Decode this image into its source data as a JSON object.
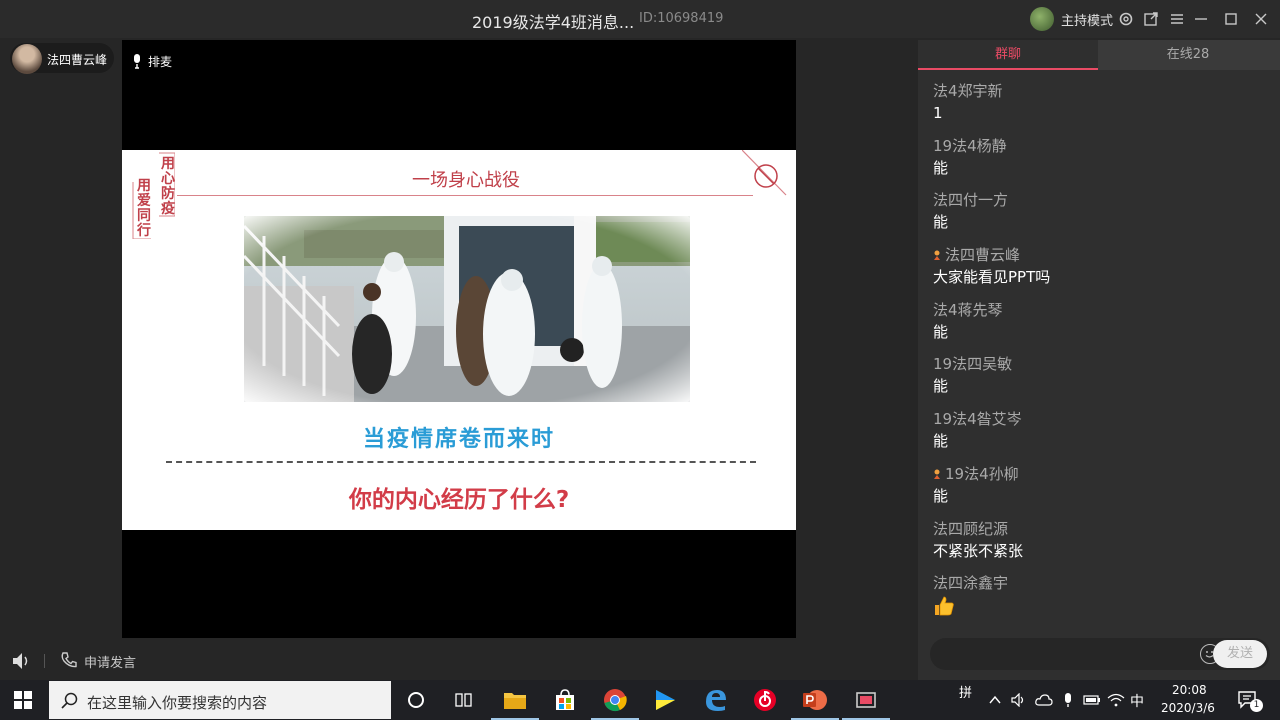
{
  "window": {
    "title": "2019级法学4班消息...",
    "room_id": "ID:10698419",
    "host_mode_label": "主持模式"
  },
  "speaker": {
    "name": "法四曹云峰"
  },
  "video": {
    "queue_label": "排麦"
  },
  "slide": {
    "stamp_col1": [
      "用",
      "心",
      "防",
      "疫"
    ],
    "stamp_col2": [
      "用",
      "爱",
      "同",
      "行"
    ],
    "title": "一场身心战役",
    "headline": "当疫情席卷而来时",
    "question": "你的内心经历了什么?"
  },
  "controls": {
    "apply_speak_label": "申请发言"
  },
  "chat": {
    "tabs": [
      {
        "label": "群聊",
        "active": true
      },
      {
        "label": "在线28",
        "active": false
      }
    ],
    "messages": [
      {
        "name": "法4郑宇新",
        "text": "1",
        "badge": false
      },
      {
        "name": "19法4杨静",
        "text": "能",
        "badge": false
      },
      {
        "name": "法四付一方",
        "text": "能",
        "badge": false
      },
      {
        "name": "法四曹云峰",
        "text": "大家能看见PPT吗",
        "badge": true
      },
      {
        "name": "法4蒋先琴",
        "text": "能",
        "badge": false
      },
      {
        "name": "19法四吴敏",
        "text": "能",
        "badge": false
      },
      {
        "name": "19法4昝艾岑",
        "text": "能",
        "badge": false
      },
      {
        "name": "19法4孙柳",
        "text": "能",
        "badge": true
      },
      {
        "name": "法四顾纪源",
        "text": "不紧张不紧张",
        "badge": false
      },
      {
        "name": "法四涂鑫宇",
        "text": "",
        "badge": false,
        "emoji": "thumbs-up"
      }
    ],
    "send_label": "发送",
    "input_value": ""
  },
  "taskbar": {
    "search_placeholder": "在这里输入你要搜索的内容",
    "ime_mode": "拼",
    "ime_lang": "中",
    "time": "20:08",
    "date": "2020/3/6",
    "notification_count": "1"
  },
  "colors": {
    "accent": "#e94b65",
    "slide_headline": "#2a9cd6",
    "slide_question": "#d23c48"
  }
}
